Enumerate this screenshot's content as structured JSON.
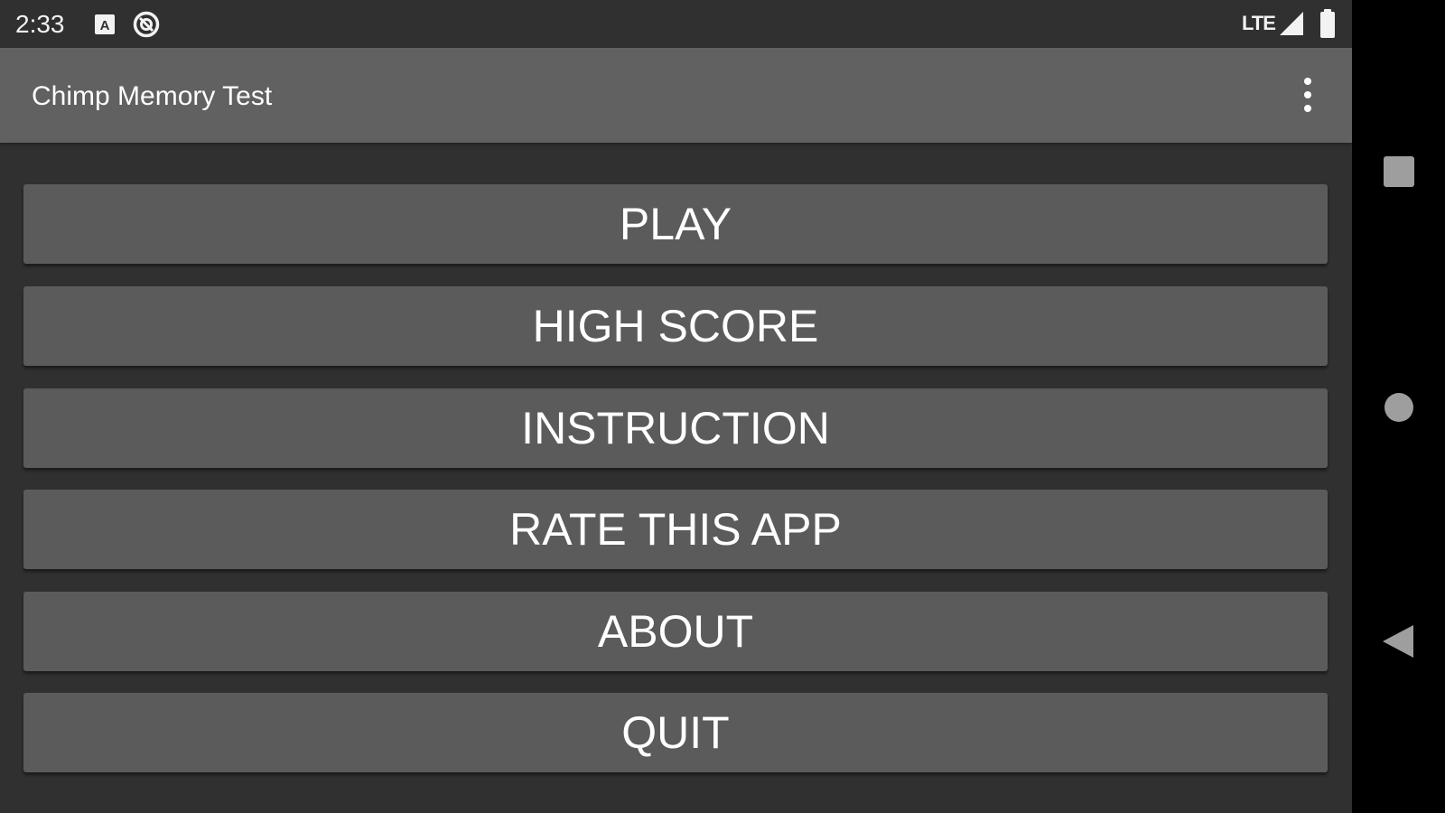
{
  "status_bar": {
    "time": "2:33",
    "network": "LTE",
    "icons": [
      "keyboard-a-icon",
      "data-saver-icon",
      "lte-signal-icon",
      "battery-icon"
    ]
  },
  "app_bar": {
    "title": "Chimp Memory Test",
    "overflow_icon": "more-vert-icon"
  },
  "menu": {
    "buttons": [
      {
        "label": "PLAY"
      },
      {
        "label": "HIGH SCORE"
      },
      {
        "label": "INSTRUCTION"
      },
      {
        "label": "RATE THIS APP"
      },
      {
        "label": "ABOUT"
      },
      {
        "label": "QUIT"
      }
    ]
  },
  "navigation_bar": {
    "icons": [
      "recents-square-icon",
      "home-circle-icon",
      "back-triangle-icon"
    ]
  },
  "colors": {
    "background": "#303030",
    "app_bar": "#616161",
    "button": "#5b5b5b",
    "text": "#ffffff",
    "nav_bar": "#000000"
  }
}
